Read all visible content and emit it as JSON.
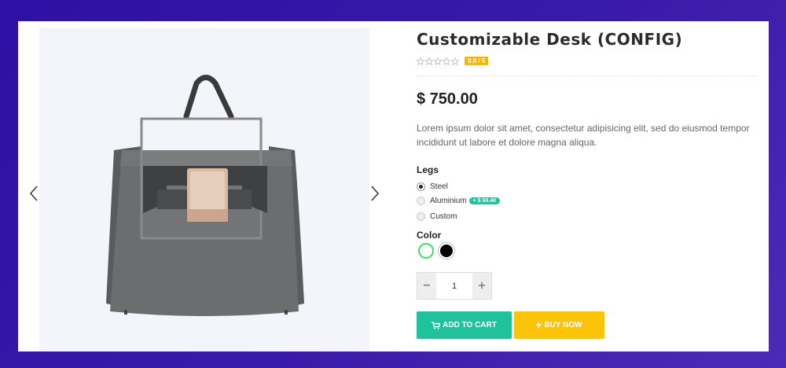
{
  "product": {
    "title": "Customizable Desk (CONFIG)",
    "rating_badge": "0.0 / 5",
    "price": "$ 750.00",
    "description": "Lorem ipsum dolor sit amet, consectetur adipisicing elit, sed do eiusmod tempor incididunt ut labore et dolore magna aliqua."
  },
  "options": {
    "legs_label": "Legs",
    "legs": [
      {
        "label": "Steel",
        "selected": true
      },
      {
        "label": "Aluminium",
        "price_tag": "+ $ 50.40",
        "selected": false
      },
      {
        "label": "Custom",
        "selected": false
      }
    ],
    "color_label": "Color",
    "colors": [
      "#ffffff",
      "#000000"
    ]
  },
  "quantity": {
    "minus": "−",
    "value": "1",
    "plus": "+"
  },
  "actions": {
    "add_to_cart": "ADD TO CART",
    "buy_now": "BUY NOW"
  },
  "theme": {
    "accent_green": "#1fc29d",
    "accent_yellow": "#fcc30b",
    "rating_orange": "#f6b700"
  }
}
